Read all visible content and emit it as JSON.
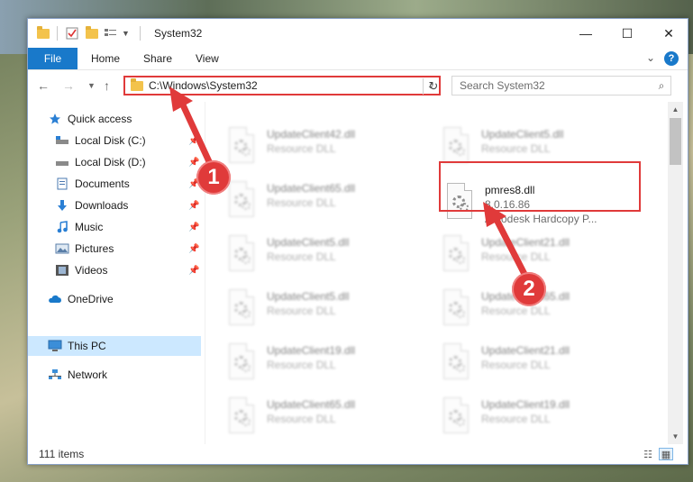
{
  "window": {
    "title": "System32",
    "minimize": "—",
    "maximize": "☐",
    "close": "✕"
  },
  "ribbon": {
    "file": "File",
    "tabs": [
      "Home",
      "Share",
      "View"
    ],
    "help": "?"
  },
  "address": {
    "path": "C:\\Windows\\System32",
    "search_placeholder": "Search System32"
  },
  "sidebar": {
    "quick_access": "Quick access",
    "items": [
      {
        "label": "Local Disk (C:)",
        "icon": "drive-icon",
        "pinned": true
      },
      {
        "label": "Local Disk (D:)",
        "icon": "drive-icon",
        "pinned": true
      },
      {
        "label": "Documents",
        "icon": "documents-icon",
        "pinned": true
      },
      {
        "label": "Downloads",
        "icon": "downloads-icon",
        "pinned": true
      },
      {
        "label": "Music",
        "icon": "music-icon",
        "pinned": true
      },
      {
        "label": "Pictures",
        "icon": "pictures-icon",
        "pinned": true
      },
      {
        "label": "Videos",
        "icon": "videos-icon",
        "pinned": true
      }
    ],
    "onedrive": "OneDrive",
    "this_pc": "This PC",
    "network": "Network"
  },
  "files": {
    "left_column": [
      {
        "name": "UpdateClient42.dll",
        "type": "Resource DLL"
      },
      {
        "name": "UpdateClient65.dll",
        "type": "Resource DLL"
      },
      {
        "name": "UpdateClient5.dll",
        "type": "Resource DLL"
      },
      {
        "name": "UpdateClient5.dll",
        "type": "Resource DLL"
      },
      {
        "name": "UpdateClient19.dll",
        "type": "Resource DLL"
      },
      {
        "name": "UpdateClient65.dll",
        "type": "Resource DLL"
      }
    ],
    "right_column": [
      {
        "name": "UpdateClient5.dll",
        "type": "Resource DLL"
      },
      {
        "name": "UpdateClient21.dll",
        "type": "Resource DLL"
      },
      {
        "name": "UpdateClient65.dll",
        "type": "Resource DLL"
      },
      {
        "name": "UpdateClient21.dll",
        "type": "Resource DLL"
      },
      {
        "name": "UpdateClient19.dll",
        "type": "Resource DLL"
      }
    ],
    "highlighted": {
      "name": "pmres8.dll",
      "version": "8.0.16.86",
      "description": "Autodesk Hardcopy P..."
    }
  },
  "status": {
    "item_count": "111 items"
  },
  "annotations": {
    "step1": "1",
    "step2": "2",
    "color": "#e03a3a"
  }
}
